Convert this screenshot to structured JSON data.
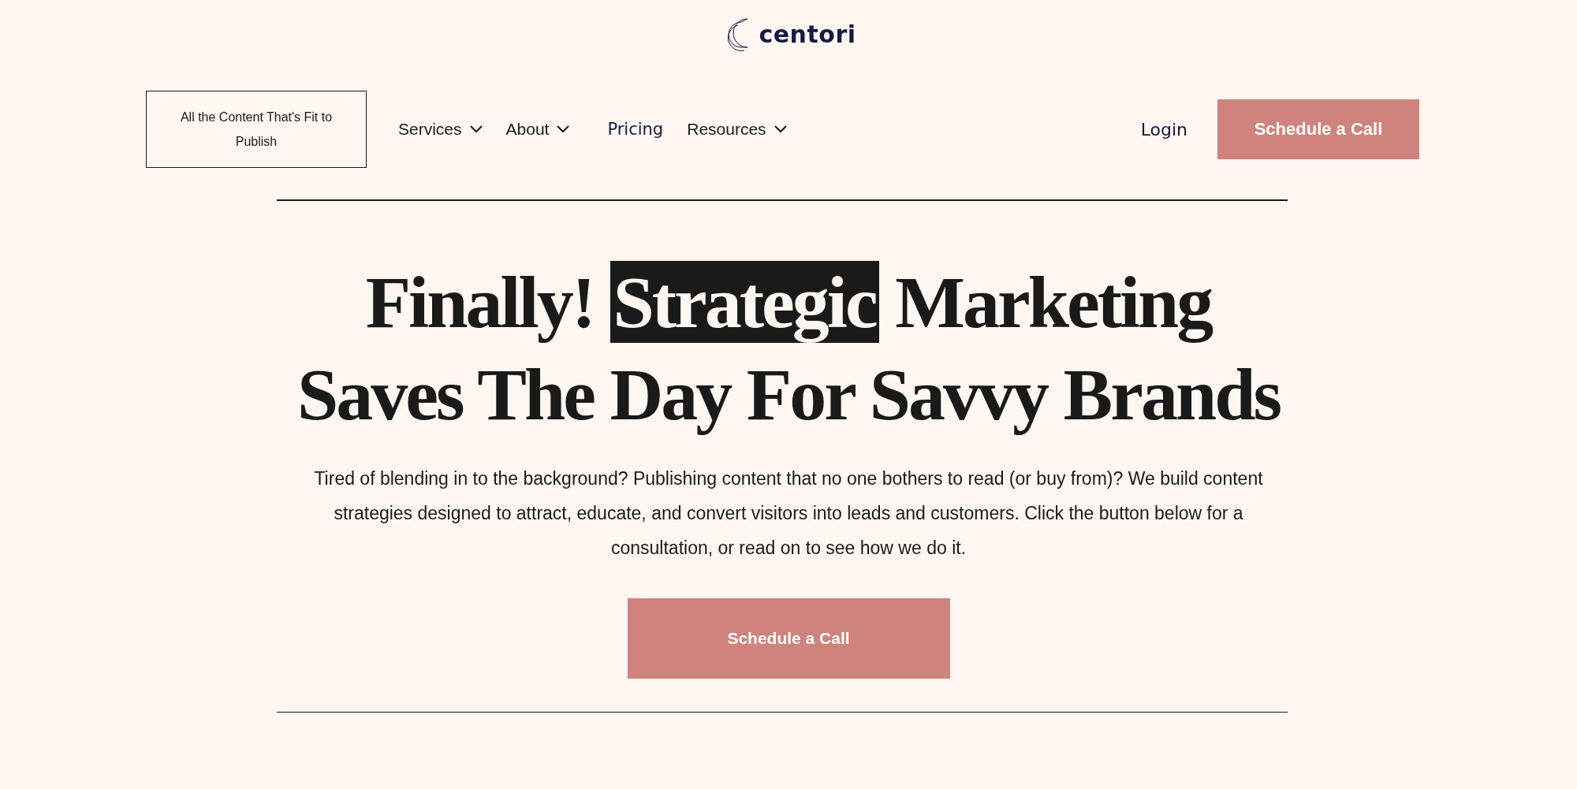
{
  "logo": {
    "text": "centori"
  },
  "tagline_box": {
    "text": "All the Content That's Fit to Publish"
  },
  "nav": [
    {
      "label": "Services",
      "kind": "dropdown"
    },
    {
      "label": "About",
      "kind": "dropdown"
    },
    {
      "label": "Pricing",
      "kind": "link"
    },
    {
      "label": "Resources",
      "kind": "dropdown"
    }
  ],
  "login": {
    "label": "Login"
  },
  "header_button": {
    "label": "Schedule a Call"
  },
  "hero": {
    "headline": [
      [
        {
          "text": "Finally! ",
          "highlighted": false
        },
        {
          "text": "Strategic",
          "highlighted": true
        },
        {
          "text": " Marketing",
          "highlighted": false
        }
      ],
      [
        {
          "text": "Saves The Day For Savvy Brands",
          "highlighted": false
        }
      ]
    ],
    "body": "Tired of blending in to the background? Publishing content that no one bothers to read (or buy from)? We build content strategies designed to attract, educate, and convert visitors into leads and customers. Click the button below for a consultation, or read on to see how we do it.",
    "button": {
      "label": "Schedule a Call"
    }
  }
}
